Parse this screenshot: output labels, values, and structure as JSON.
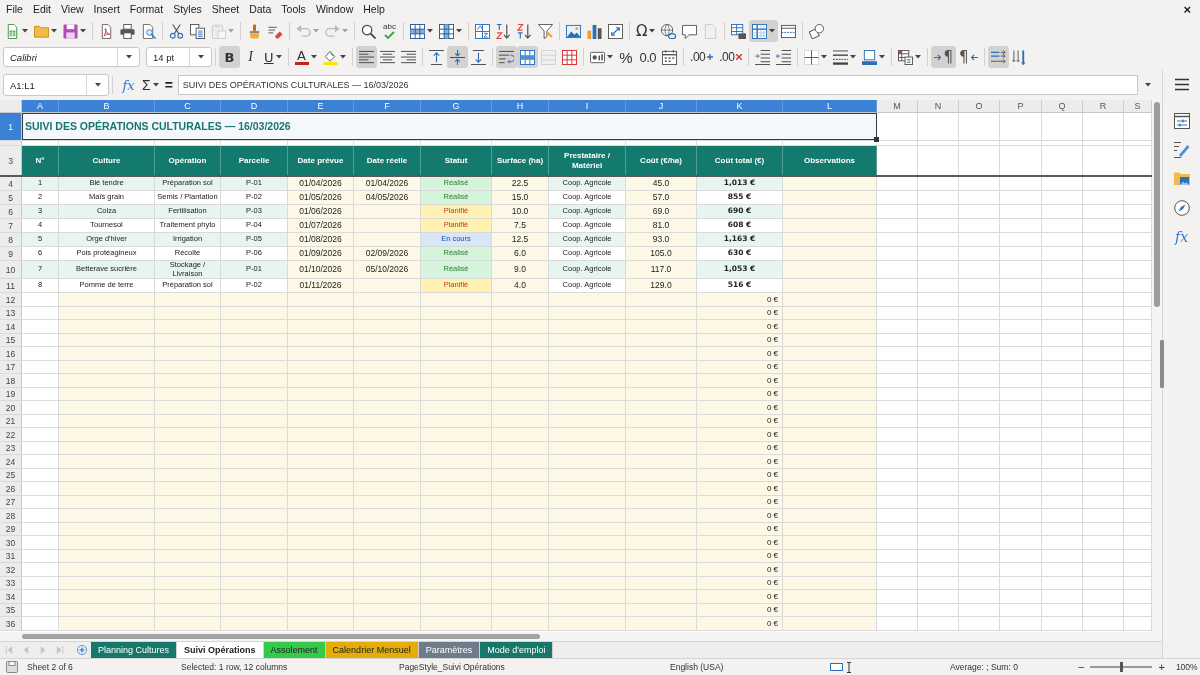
{
  "menu_bar": {
    "items": [
      "File",
      "Edit",
      "View",
      "Insert",
      "Format",
      "Styles",
      "Sheet",
      "Data",
      "Tools",
      "Window",
      "Help"
    ],
    "close_document": "×"
  },
  "standard_toolbar": {
    "paste": {
      "disabled": true
    },
    "undo": {
      "disabled": true
    },
    "redo": {
      "disabled": true
    },
    "spelling_label": "abc",
    "special_character_label": "Ω",
    "header_footer": {
      "disabled": true
    },
    "freeze": {
      "pressed": true
    }
  },
  "formatting_toolbar": {
    "font_name": "Calibri",
    "font_size": "14 pt",
    "bold": {
      "label": "B",
      "pressed": true
    },
    "italic": {
      "label": "I",
      "pressed": false
    },
    "underline": {
      "label": "U",
      "pressed": false
    },
    "font_color_label": "A",
    "align_left": {
      "pressed": true
    },
    "align_center": {
      "pressed": false
    },
    "align_right": {
      "pressed": false
    },
    "align_top": {
      "pressed": false
    },
    "center_vertically": {
      "pressed": true
    },
    "align_bottom": {
      "pressed": false
    },
    "wrap_text": {
      "pressed": true
    },
    "merge_center": {
      "pressed": true
    },
    "merge_cells": {
      "disabled": true
    },
    "percent_label": "%",
    "number_label": "0.0",
    "add_decimal_label": ".00",
    "delete_decimal_label": ".00",
    "ltr_paragraph": {
      "label": "¶",
      "pressed": true
    },
    "rtl_paragraph": {
      "label": "¶",
      "pressed": false
    },
    "text_left_to_right": {
      "pressed": true
    }
  },
  "formula_bar": {
    "name_box": "A1:L1",
    "function_wizard": "fx",
    "sum": "Σ",
    "equals": "=",
    "content": "SUIVI DES OPÉRATIONS CULTURALES — 16/03/2026"
  },
  "grid": {
    "column_headers": [
      {
        "label": "A",
        "selected": true
      },
      {
        "label": "B",
        "selected": true
      },
      {
        "label": "C",
        "selected": true
      },
      {
        "label": "D",
        "selected": true
      },
      {
        "label": "E",
        "selected": true
      },
      {
        "label": "F",
        "selected": true
      },
      {
        "label": "G",
        "selected": true
      },
      {
        "label": "H",
        "selected": true
      },
      {
        "label": "I",
        "selected": true
      },
      {
        "label": "J",
        "selected": true
      },
      {
        "label": "K",
        "selected": true
      },
      {
        "label": "L",
        "selected": true
      },
      {
        "label": "M",
        "selected": false
      },
      {
        "label": "N",
        "selected": false
      },
      {
        "label": "O",
        "selected": false
      },
      {
        "label": "P",
        "selected": false
      },
      {
        "label": "Q",
        "selected": false
      },
      {
        "label": "R",
        "selected": false
      },
      {
        "label": "S",
        "selected": false
      }
    ],
    "title_row": {
      "row_header": {
        "label": "1",
        "selected": true
      },
      "title": "SUIVI DES OPÉRATIONS CULTURALES — 16/03/2026"
    },
    "header_row": {
      "row_header": {
        "label": "3",
        "selected": false
      },
      "cells": [
        "N°",
        "Culture",
        "Opération",
        "Parcelle",
        "Date prévue",
        "Date réelle",
        "Statut",
        "Surface (ha)",
        "Prestataire / Matériel",
        "Coût (€/ha)",
        "Coût total (€)",
        "Observations"
      ]
    },
    "data_rows": [
      {
        "row_header": {
          "label": "4",
          "selected": false
        },
        "no": "1",
        "culture": "Blé tendre",
        "operation": "Préparation sol",
        "parcelle": "P-01",
        "date_prevue": "01/04/2026",
        "date_reelle": "01/04/2026",
        "statut": {
          "label": "Réalisé",
          "kind": "done"
        },
        "surface": "22.5",
        "prestataire": "Coop. Agricole",
        "cout_ha": "45.0",
        "cout_total": "1,013 €"
      },
      {
        "row_header": {
          "label": "5",
          "selected": false
        },
        "no": "2",
        "culture": "Maïs grain",
        "operation": "Semis / Plantation",
        "parcelle": "P-02",
        "date_prevue": "01/05/2026",
        "date_reelle": "04/05/2026",
        "statut": {
          "label": "Réalisé",
          "kind": "done"
        },
        "surface": "15.0",
        "prestataire": "Coop. Agricole",
        "cout_ha": "57.0",
        "cout_total": "855 €"
      },
      {
        "row_header": {
          "label": "6",
          "selected": false
        },
        "no": "3",
        "culture": "Colza",
        "operation": "Fertilisation",
        "parcelle": "P-03",
        "date_prevue": "01/06/2026",
        "statut": {
          "label": "Planifié",
          "kind": "planned"
        },
        "surface": "10.0",
        "prestataire": "Coop. Agricole",
        "cout_ha": "69.0",
        "cout_total": "690 €"
      },
      {
        "row_header": {
          "label": "7",
          "selected": false
        },
        "no": "4",
        "culture": "Tournesol",
        "operation": "Traitement phyto",
        "parcelle": "P-04",
        "date_prevue": "01/07/2026",
        "statut": {
          "label": "Planifié",
          "kind": "planned"
        },
        "surface": "7.5",
        "prestataire": "Coop. Agricole",
        "cout_ha": "81.0",
        "cout_total": "608 €"
      },
      {
        "row_header": {
          "label": "8",
          "selected": false
        },
        "no": "5",
        "culture": "Orge d'hiver",
        "operation": "Irrigation",
        "parcelle": "P-05",
        "date_prevue": "01/08/2026",
        "statut": {
          "label": "En cours",
          "kind": "in_progress"
        },
        "surface": "12.5",
        "prestataire": "Coop. Agricole",
        "cout_ha": "93.0",
        "cout_total": "1,163 €"
      },
      {
        "row_header": {
          "label": "9",
          "selected": false
        },
        "no": "6",
        "culture": "Pois protéagineux",
        "operation": "Récolte",
        "parcelle": "P-06",
        "date_prevue": "01/09/2026",
        "date_reelle": "02/09/2026",
        "statut": {
          "label": "Réalisé",
          "kind": "done"
        },
        "surface": "6.0",
        "prestataire": "Coop. Agricole",
        "cout_ha": "105.0",
        "cout_total": "630 €"
      },
      {
        "row_header": {
          "label": "10",
          "selected": false
        },
        "no": "7",
        "culture": "Betterave sucrière",
        "operation": "Stockage / Livraison",
        "parcelle": "P-01",
        "date_prevue": "01/10/2026",
        "date_reelle": "05/10/2026",
        "statut": {
          "label": "Réalisé",
          "kind": "done"
        },
        "surface": "9.0",
        "prestataire": "Coop. Agricole",
        "cout_ha": "117.0",
        "cout_total": "1,053 €"
      },
      {
        "row_header": {
          "label": "11",
          "selected": false
        },
        "no": "8",
        "culture": "Pomme de terre",
        "operation": "Préparation sol",
        "parcelle": "P-02",
        "date_prevue": "01/11/2026",
        "statut": {
          "label": "Planifié",
          "kind": "planned"
        },
        "surface": "4.0",
        "prestataire": "Coop. Agricole",
        "cout_ha": "129.0",
        "cout_total": "516 €"
      }
    ],
    "empty_rows": [
      {
        "row_header": {
          "label": "12",
          "selected": false
        },
        "cout_total": "0 €"
      },
      {
        "row_header": {
          "label": "13",
          "selected": false
        },
        "cout_total": "0 €"
      },
      {
        "row_header": {
          "label": "14",
          "selected": false
        },
        "cout_total": "0 €"
      },
      {
        "row_header": {
          "label": "15",
          "selected": false
        },
        "cout_total": "0 €"
      },
      {
        "row_header": {
          "label": "16",
          "selected": false
        },
        "cout_total": "0 €"
      },
      {
        "row_header": {
          "label": "17",
          "selected": false
        },
        "cout_total": "0 €"
      },
      {
        "row_header": {
          "label": "18",
          "selected": false
        },
        "cout_total": "0 €"
      },
      {
        "row_header": {
          "label": "19",
          "selected": false
        },
        "cout_total": "0 €"
      },
      {
        "row_header": {
          "label": "20",
          "selected": false
        },
        "cout_total": "0 €"
      },
      {
        "row_header": {
          "label": "21",
          "selected": false
        },
        "cout_total": "0 €"
      },
      {
        "row_header": {
          "label": "22",
          "selected": false
        },
        "cout_total": "0 €"
      },
      {
        "row_header": {
          "label": "23",
          "selected": false
        },
        "cout_total": "0 €"
      },
      {
        "row_header": {
          "label": "24",
          "selected": false
        },
        "cout_total": "0 €"
      },
      {
        "row_header": {
          "label": "25",
          "selected": false
        },
        "cout_total": "0 €"
      },
      {
        "row_header": {
          "label": "26",
          "selected": false
        },
        "cout_total": "0 €"
      },
      {
        "row_header": {
          "label": "27",
          "selected": false
        },
        "cout_total": "0 €"
      },
      {
        "row_header": {
          "label": "28",
          "selected": false
        },
        "cout_total": "0 €"
      },
      {
        "row_header": {
          "label": "29",
          "selected": false
        },
        "cout_total": "0 €"
      },
      {
        "row_header": {
          "label": "30",
          "selected": false
        },
        "cout_total": "0 €"
      },
      {
        "row_header": {
          "label": "31",
          "selected": false
        },
        "cout_total": "0 €"
      },
      {
        "row_header": {
          "label": "32",
          "selected": false
        },
        "cout_total": "0 €"
      },
      {
        "row_header": {
          "label": "33",
          "selected": false
        },
        "cout_total": "0 €"
      },
      {
        "row_header": {
          "label": "34",
          "selected": false
        },
        "cout_total": "0 €"
      },
      {
        "row_header": {
          "label": "35",
          "selected": false
        },
        "cout_total": "0 €"
      },
      {
        "row_header": {
          "label": "36",
          "selected": false
        },
        "cout_total": "0 €"
      }
    ]
  },
  "sheet_tabs_bar": {
    "navigation_disabled": true,
    "tabs": [
      {
        "label": "Planning Cultures",
        "selected": false,
        "color": "#17776b"
      },
      {
        "label": "Suivi Opérations",
        "selected": true
      },
      {
        "label": "Assolement",
        "selected": false,
        "color": "#35c94b"
      },
      {
        "label": "Calendrier Mensuel",
        "selected": false,
        "color": "#e4ad0a"
      },
      {
        "label": "Paramètres",
        "selected": false,
        "color": "#6e7b8b"
      },
      {
        "label": "Mode d'emploi",
        "selected": false,
        "color": "#17776b"
      }
    ]
  },
  "sidebar": {
    "functions_label": "fx"
  },
  "status_bar": {
    "sheet_position": "Sheet 2 of 6",
    "selection": "Selected: 1 row, 12 columns",
    "page_style": "PageStyle_Suivi Opérations",
    "language": "English (USA)",
    "summary": "Average: ; Sum: 0",
    "zoom_out": "−",
    "zoom_slider": {
      "level": 0.5
    },
    "zoom_in": "+",
    "zoom": "100%"
  }
}
